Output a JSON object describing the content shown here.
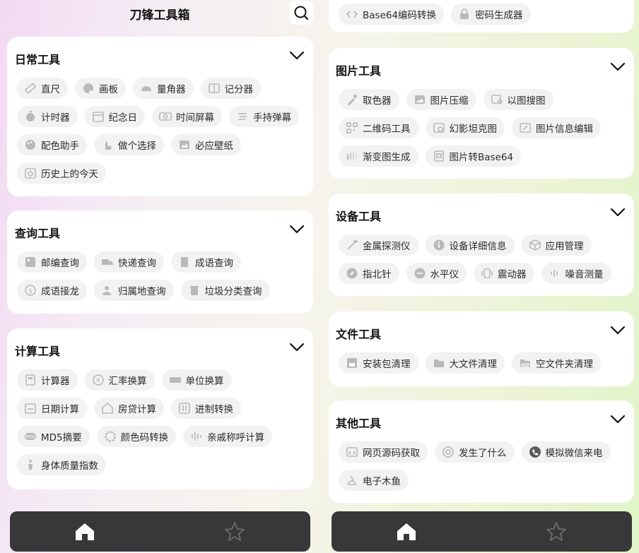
{
  "app": {
    "title": "刀锋工具箱"
  },
  "colors": {
    "icon_gray": "#b9b9b9",
    "nav_bg": "#38383a",
    "card_bg": "#ffffff",
    "chip_bg": "#f2f2f2"
  },
  "left": {
    "daily": {
      "title": "日常工具",
      "rows": [
        [
          {
            "label": "直尺",
            "icon": "ruler-icon"
          },
          {
            "label": "画板",
            "icon": "palette-icon"
          },
          {
            "label": "量角器",
            "icon": "protractor-icon"
          },
          {
            "label": "记分器",
            "icon": "scoreboard-icon"
          }
        ],
        [
          {
            "label": "计时器",
            "icon": "stopwatch-icon"
          },
          {
            "label": "纪念日",
            "icon": "calendar-icon"
          },
          {
            "label": "时间屏幕",
            "icon": "clock-screen-icon"
          },
          {
            "label": "手持弹幕",
            "icon": "marquee-icon"
          }
        ],
        [
          {
            "label": "配色助手",
            "icon": "color-palette-icon"
          },
          {
            "label": "做个选择",
            "icon": "hand-icon"
          },
          {
            "label": "必应壁纸",
            "icon": "wallpaper-icon"
          }
        ],
        [
          {
            "label": "历史上的今天",
            "icon": "history-calendar-icon"
          }
        ]
      ]
    },
    "query": {
      "title": "查询工具",
      "rows": [
        [
          {
            "label": "邮编查询",
            "icon": "postcode-icon"
          },
          {
            "label": "快递查询",
            "icon": "truck-icon"
          },
          {
            "label": "成语查询",
            "icon": "book-icon"
          }
        ],
        [
          {
            "label": "成语接龙",
            "icon": "dragon-icon"
          },
          {
            "label": "归属地查询",
            "icon": "location-icon"
          },
          {
            "label": "垃圾分类查询",
            "icon": "trash-icon"
          }
        ]
      ]
    },
    "calc": {
      "title": "计算工具",
      "rows": [
        [
          {
            "label": "计算器",
            "icon": "calculator-icon"
          },
          {
            "label": "汇率换算",
            "icon": "exchange-icon"
          },
          {
            "label": "单位换算",
            "icon": "unit-icon"
          }
        ],
        [
          {
            "label": "日期计算",
            "icon": "date-calc-icon"
          },
          {
            "label": "房贷计算",
            "icon": "house-icon"
          },
          {
            "label": "进制转换",
            "icon": "binary-icon"
          }
        ],
        [
          {
            "label": "MD5摘要",
            "icon": "md5-icon"
          },
          {
            "label": "颜色码转换",
            "icon": "color-ring-icon"
          },
          {
            "label": "亲戚称呼计算",
            "icon": "family-icon"
          }
        ],
        [
          {
            "label": "身体质量指数",
            "icon": "body-icon"
          }
        ]
      ]
    }
  },
  "right": {
    "encode": {
      "rows": [
        [
          {
            "label": "Base64编码转换",
            "icon": "code-icon"
          },
          {
            "label": "密码生成器",
            "icon": "lock-icon"
          }
        ]
      ]
    },
    "image": {
      "title": "图片工具",
      "rows": [
        [
          {
            "label": "取色器",
            "icon": "eyedropper-icon"
          },
          {
            "label": "图片压缩",
            "icon": "image-compress-icon"
          },
          {
            "label": "以图搜图",
            "icon": "image-search-icon"
          }
        ],
        [
          {
            "label": "二维码工具",
            "icon": "qrcode-icon"
          },
          {
            "label": "幻影坦克图",
            "icon": "phantom-image-icon"
          },
          {
            "label": "图片信息编辑",
            "icon": "image-edit-icon"
          }
        ],
        [
          {
            "label": "渐变图生成",
            "icon": "gradient-icon"
          },
          {
            "label": "图片转Base64",
            "icon": "image-base64-icon"
          }
        ]
      ]
    },
    "device": {
      "title": "设备工具",
      "rows": [
        [
          {
            "label": "金属探测仪",
            "icon": "metal-detector-icon"
          },
          {
            "label": "设备详细信息",
            "icon": "info-icon"
          },
          {
            "label": "应用管理",
            "icon": "box-icon"
          }
        ],
        [
          {
            "label": "指北针",
            "icon": "compass-icon"
          },
          {
            "label": "水平仪",
            "icon": "level-icon"
          },
          {
            "label": "震动器",
            "icon": "vibrate-icon"
          },
          {
            "label": "噪音测量",
            "icon": "noise-icon"
          }
        ]
      ]
    },
    "file": {
      "title": "文件工具",
      "rows": [
        [
          {
            "label": "安装包清理",
            "icon": "package-icon"
          },
          {
            "label": "大文件清理",
            "icon": "folder-icon"
          },
          {
            "label": "空文件夹清理",
            "icon": "empty-folder-icon"
          }
        ]
      ]
    },
    "other": {
      "title": "其他工具",
      "rows": [
        [
          {
            "label": "网页源码获取",
            "icon": "web-source-icon"
          },
          {
            "label": "发生了什么",
            "icon": "question-circle-icon"
          },
          {
            "label": "模拟微信来电",
            "icon": "wechat-call-icon"
          }
        ],
        [
          {
            "label": "电子木鱼",
            "icon": "wooden-fish-icon"
          }
        ]
      ]
    }
  }
}
